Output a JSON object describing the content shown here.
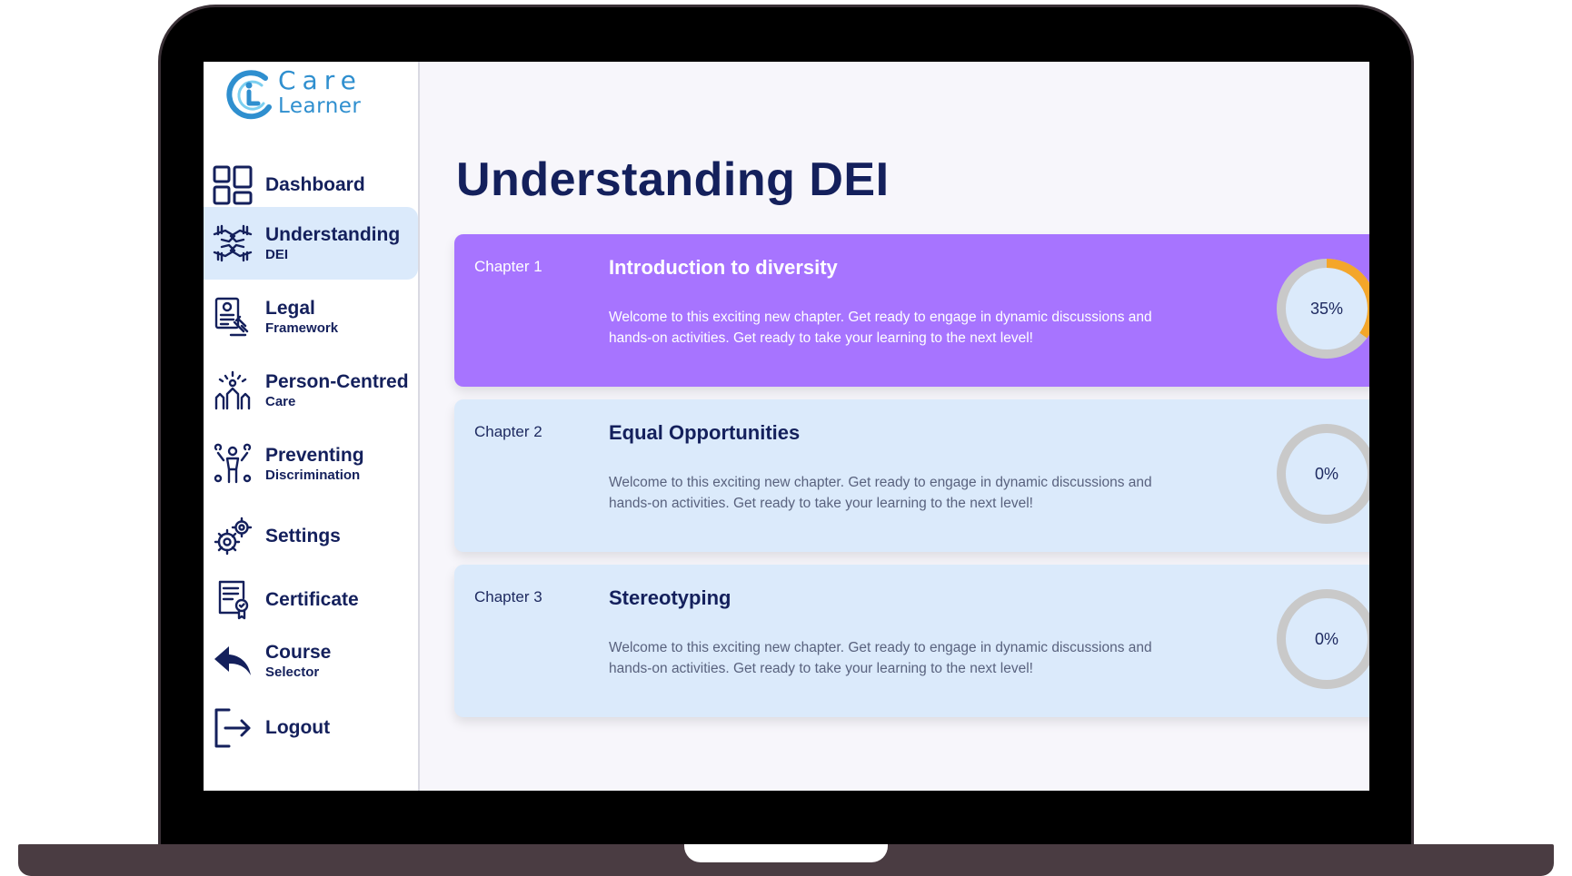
{
  "brand": {
    "line1": "Care",
    "line2": "Learner"
  },
  "sidebar": {
    "items": [
      {
        "label": "Dashboard",
        "sub": "",
        "icon": "dashboard-icon"
      },
      {
        "label": "Understanding",
        "sub": "DEI",
        "icon": "hands-together-icon",
        "active": true
      },
      {
        "label": "Legal",
        "sub": "Framework",
        "icon": "legal-document-gavel-icon"
      },
      {
        "label": "Person-Centred",
        "sub": "Care",
        "icon": "raised-hands-icon"
      },
      {
        "label": "Preventing",
        "sub": "Discrimination",
        "icon": "broken-chain-person-icon"
      },
      {
        "label": "Settings",
        "sub": "",
        "icon": "gears-icon"
      },
      {
        "label": "Certificate",
        "sub": "",
        "icon": "certificate-icon"
      },
      {
        "label": "Course",
        "sub": "Selector",
        "icon": "back-arrow-icon"
      },
      {
        "label": "Logout",
        "sub": "",
        "icon": "logout-icon"
      }
    ]
  },
  "main": {
    "title": "Understanding DEI",
    "chapters": [
      {
        "number": "Chapter 1",
        "title": "Introduction to diversity",
        "description": "Welcome to this exciting new chapter. Get ready to engage in dynamic discussions and hands-on activities. Get ready to take your learning to the next level!",
        "progress_label": "35%",
        "progress": 0.35,
        "active": true
      },
      {
        "number": "Chapter 2",
        "title": "Equal Opportunities",
        "description": "Welcome to this exciting new chapter. Get ready to engage in dynamic discussions and hands-on activities. Get ready to take your learning to the next level!",
        "progress_label": "0%",
        "progress": 0,
        "active": false
      },
      {
        "number": "Chapter 3",
        "title": "Stereotyping",
        "description": "Welcome to this exciting new chapter. Get ready to engage in dynamic discussions and hands-on activities. Get ready to take your learning to the next level!",
        "progress_label": "0%",
        "progress": 0,
        "active": false
      }
    ]
  },
  "colors": {
    "accent_purple": "#a774ff",
    "card_blue": "#dbeafb",
    "navy": "#14205c",
    "progress_orange": "#f4a62a",
    "ring_gray": "#c9c9c9",
    "brand_blue": "#2f8fcf"
  }
}
